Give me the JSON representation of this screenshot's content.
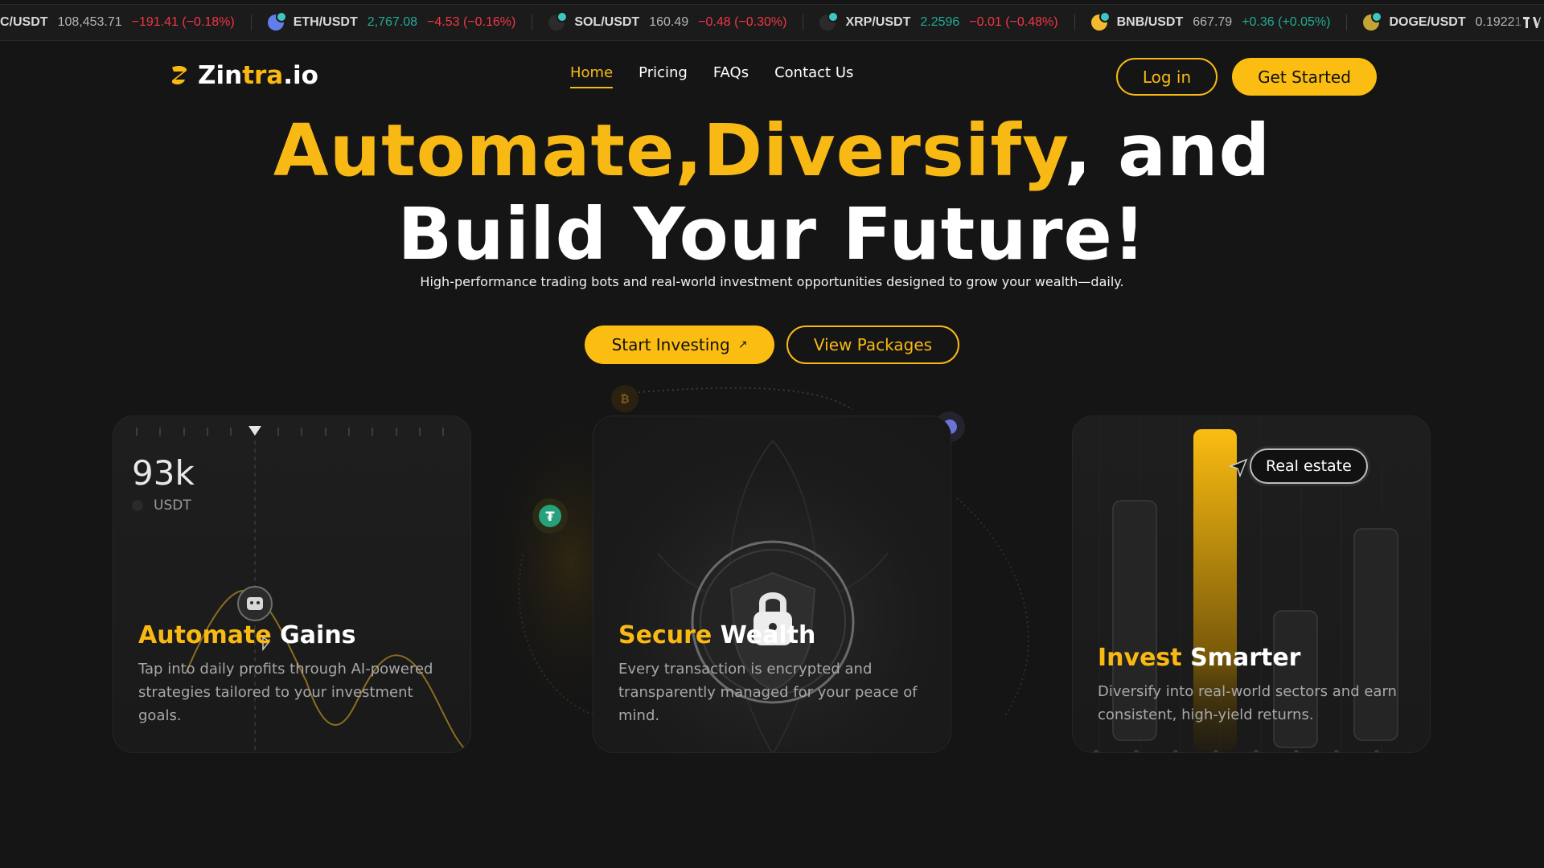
{
  "ticker": [
    {
      "symbol": "C/USDT",
      "price": "108,453.71",
      "change": "−191.41 (−0.18%)",
      "dir": "down",
      "price_dir": "neutral",
      "icon": "bitcoin-icon",
      "color": "#f7931a"
    },
    {
      "symbol": "ETH/USDT",
      "price": "2,767.08",
      "change": "−4.53 (−0.16%)",
      "dir": "down",
      "price_dir": "up",
      "icon": "ethereum-icon",
      "color": "#627eea"
    },
    {
      "symbol": "SOL/USDT",
      "price": "160.49",
      "change": "−0.48 (−0.30%)",
      "dir": "down",
      "price_dir": "neutral",
      "icon": "solana-icon",
      "color": "#2b2b2b"
    },
    {
      "symbol": "XRP/USDT",
      "price": "2.2596",
      "change": "−0.01 (−0.48%)",
      "dir": "down",
      "price_dir": "up",
      "icon": "xrp-icon",
      "color": "#2b2b2b"
    },
    {
      "symbol": "BNB/USDT",
      "price": "667.79",
      "change": "+0.36 (+0.05%)",
      "dir": "up",
      "price_dir": "neutral",
      "icon": "bnb-icon",
      "color": "#f3ba2f"
    },
    {
      "symbol": "DOGE/USDT",
      "price": "0.19221",
      "change": "−",
      "dir": "down",
      "price_dir": "neutral",
      "icon": "dogecoin-icon",
      "color": "#c2a633"
    }
  ],
  "header": {
    "logo": {
      "part1": "Zin",
      "part2": "tra",
      "part3": ".io"
    },
    "nav": [
      {
        "label": "Home",
        "active": true
      },
      {
        "label": "Pricing",
        "active": false
      },
      {
        "label": "FAQs",
        "active": false
      },
      {
        "label": "Contact Us",
        "active": false
      }
    ],
    "login_label": "Log in",
    "get_started_label": "Get Started"
  },
  "hero": {
    "title_yellow_1": "Automate,",
    "title_yellow_2": "Diversify",
    "title_white_1": ", and",
    "title_line2": "Build Your Future!",
    "subtitle": "High-performance trading bots and real-world investment opportunities designed to grow your wealth—daily.",
    "start_label": "Start Investing",
    "start_arrow": "↗",
    "view_label": "View Packages"
  },
  "cards": [
    {
      "title_yellow": "Automate",
      "title_white": "Gains",
      "desc": "Tap into daily profits through AI-powered strategies tailored to your investment goals.",
      "value": "93k",
      "unit": "USDT"
    },
    {
      "title_yellow": "Secure",
      "title_white": "Wealth",
      "desc": "Every transaction is encrypted and transparently managed for your peace of mind."
    },
    {
      "title_yellow": "Invest",
      "title_white": "Smarter",
      "desc": "Diversify into real-world sectors and earn consistent, high-yield returns.",
      "tag": "Real estate"
    }
  ],
  "colors": {
    "accent": "#f9b914",
    "background": "#151515",
    "card": "#1e1e1e",
    "up": "#22ab94",
    "down": "#f23645"
  }
}
